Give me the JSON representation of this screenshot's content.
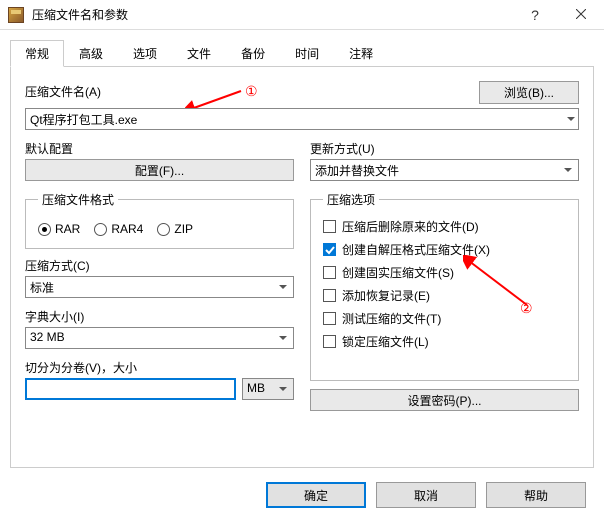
{
  "window": {
    "title": "压缩文件名和参数"
  },
  "tabs": [
    "常规",
    "高级",
    "选项",
    "文件",
    "备份",
    "时间",
    "注释"
  ],
  "labels": {
    "archive_name": "压缩文件名(A)",
    "browse": "浏览(B)...",
    "default_profile": "默认配置",
    "profiles_btn": "配置(F)...",
    "update_mode": "更新方式(U)",
    "archive_format": "压缩文件格式",
    "comp_method": "压缩方式(C)",
    "dict_size": "字典大小(I)",
    "split_size": "切分为分卷(V)，大小",
    "arch_options": "压缩选项",
    "set_password": "设置密码(P)..."
  },
  "values": {
    "archive_name": "Qt程序打包工具.exe",
    "update_mode": "添加并替换文件",
    "comp_method": "标准",
    "dict_size": "32 MB",
    "split_size": "",
    "split_unit": "MB"
  },
  "formats": {
    "rar": "RAR",
    "rar4": "RAR4",
    "zip": "ZIP",
    "selected": "rar"
  },
  "options": [
    {
      "label": "压缩后删除原来的文件(D)",
      "checked": false
    },
    {
      "label": "创建自解压格式压缩文件(X)",
      "checked": true
    },
    {
      "label": "创建固实压缩文件(S)",
      "checked": false
    },
    {
      "label": "添加恢复记录(E)",
      "checked": false
    },
    {
      "label": "测试压缩的文件(T)",
      "checked": false
    },
    {
      "label": "锁定压缩文件(L)",
      "checked": false
    }
  ],
  "buttons": {
    "ok": "确定",
    "cancel": "取消",
    "help": "帮助"
  },
  "annotations": {
    "a1": "①",
    "a2": "②"
  }
}
